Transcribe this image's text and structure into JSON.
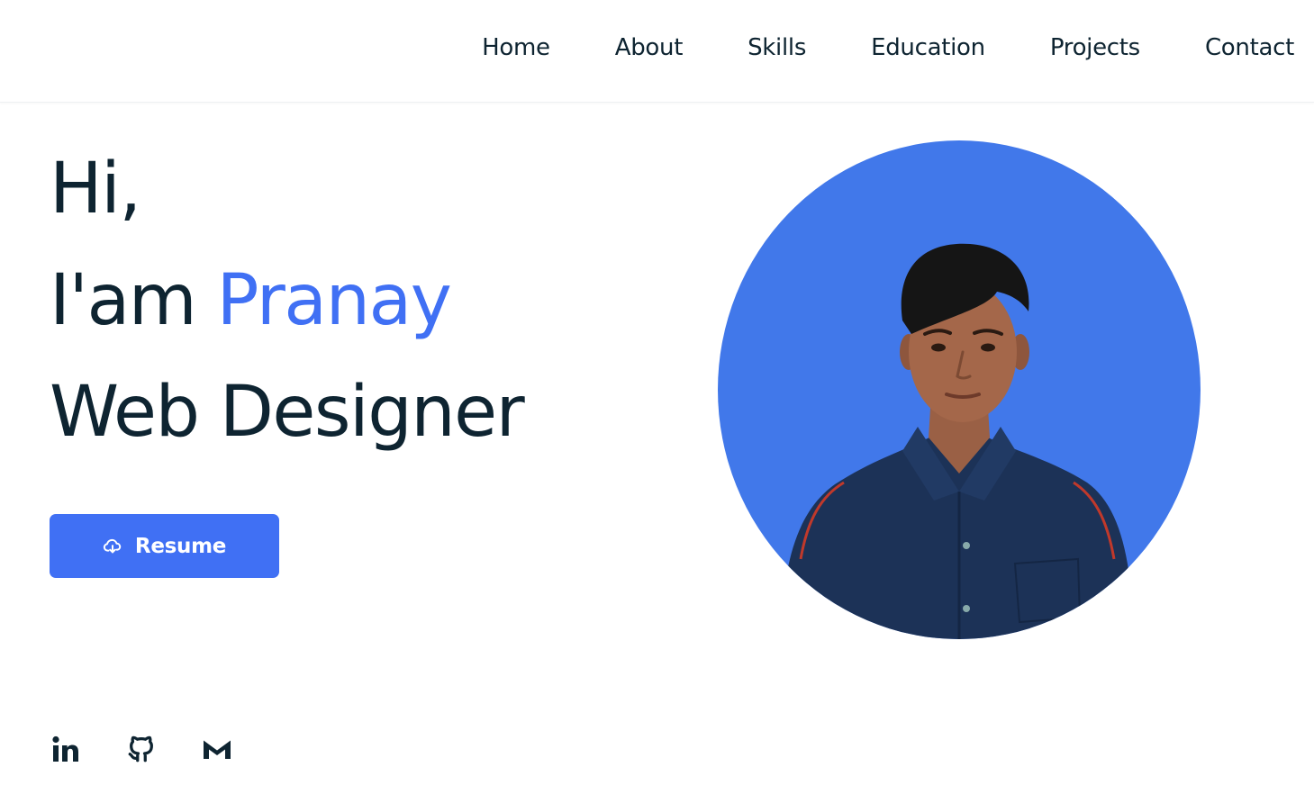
{
  "nav": {
    "items": [
      "Home",
      "About",
      "Skills",
      "Education",
      "Projects",
      "Contact"
    ]
  },
  "hero": {
    "greeting": "Hi,",
    "intro_prefix": "I'am ",
    "name": "Pranay",
    "role": "Web Designer"
  },
  "resume_button": {
    "label": "Resume",
    "icon": "cloud-download-icon"
  },
  "socials": [
    {
      "icon": "linkedin-icon"
    },
    {
      "icon": "github-icon"
    },
    {
      "icon": "gmail-icon"
    }
  ],
  "colors": {
    "accent": "#4070f4",
    "text": "#0e2431",
    "photo_bg": "#4178ea",
    "shirt": "#1c3257"
  }
}
